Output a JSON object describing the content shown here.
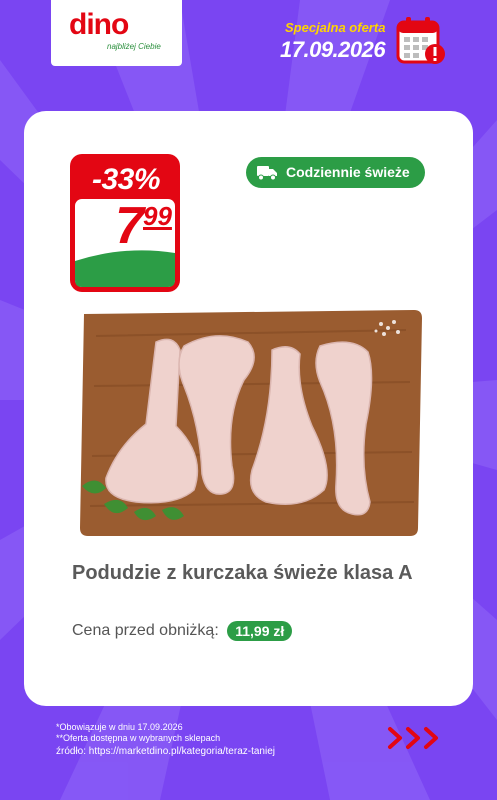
{
  "brand": {
    "name": "dino",
    "tagline": "najbliżej Ciebie"
  },
  "promo": {
    "label": "Specjalna oferta",
    "date": "17.09.2026"
  },
  "badge": {
    "label": "Codziennie świeże"
  },
  "price": {
    "discount": "-33%",
    "integer": "7",
    "decimal": "99"
  },
  "product": {
    "title": "Podudzie z kurczaka świeże klasa A",
    "previous_price_label": "Cena przed obniżką:",
    "previous_price_value": "11,99 zł"
  },
  "footer": {
    "note_validity": "*Obowiązuje w dniu 17.09.2026",
    "note_availability": "**Oferta dostępna w wybranych sklepach",
    "source": "źródło: https://marketdino.pl/kategoria/teraz-taniej"
  },
  "colors": {
    "background": "#7a45f2",
    "brand_red": "#e30613",
    "fresh_green": "#2c9d46",
    "promo_yellow": "#ffd400"
  },
  "icons": [
    "calendar-alert-icon",
    "delivery-truck-icon",
    "chevrons-right-icon"
  ]
}
